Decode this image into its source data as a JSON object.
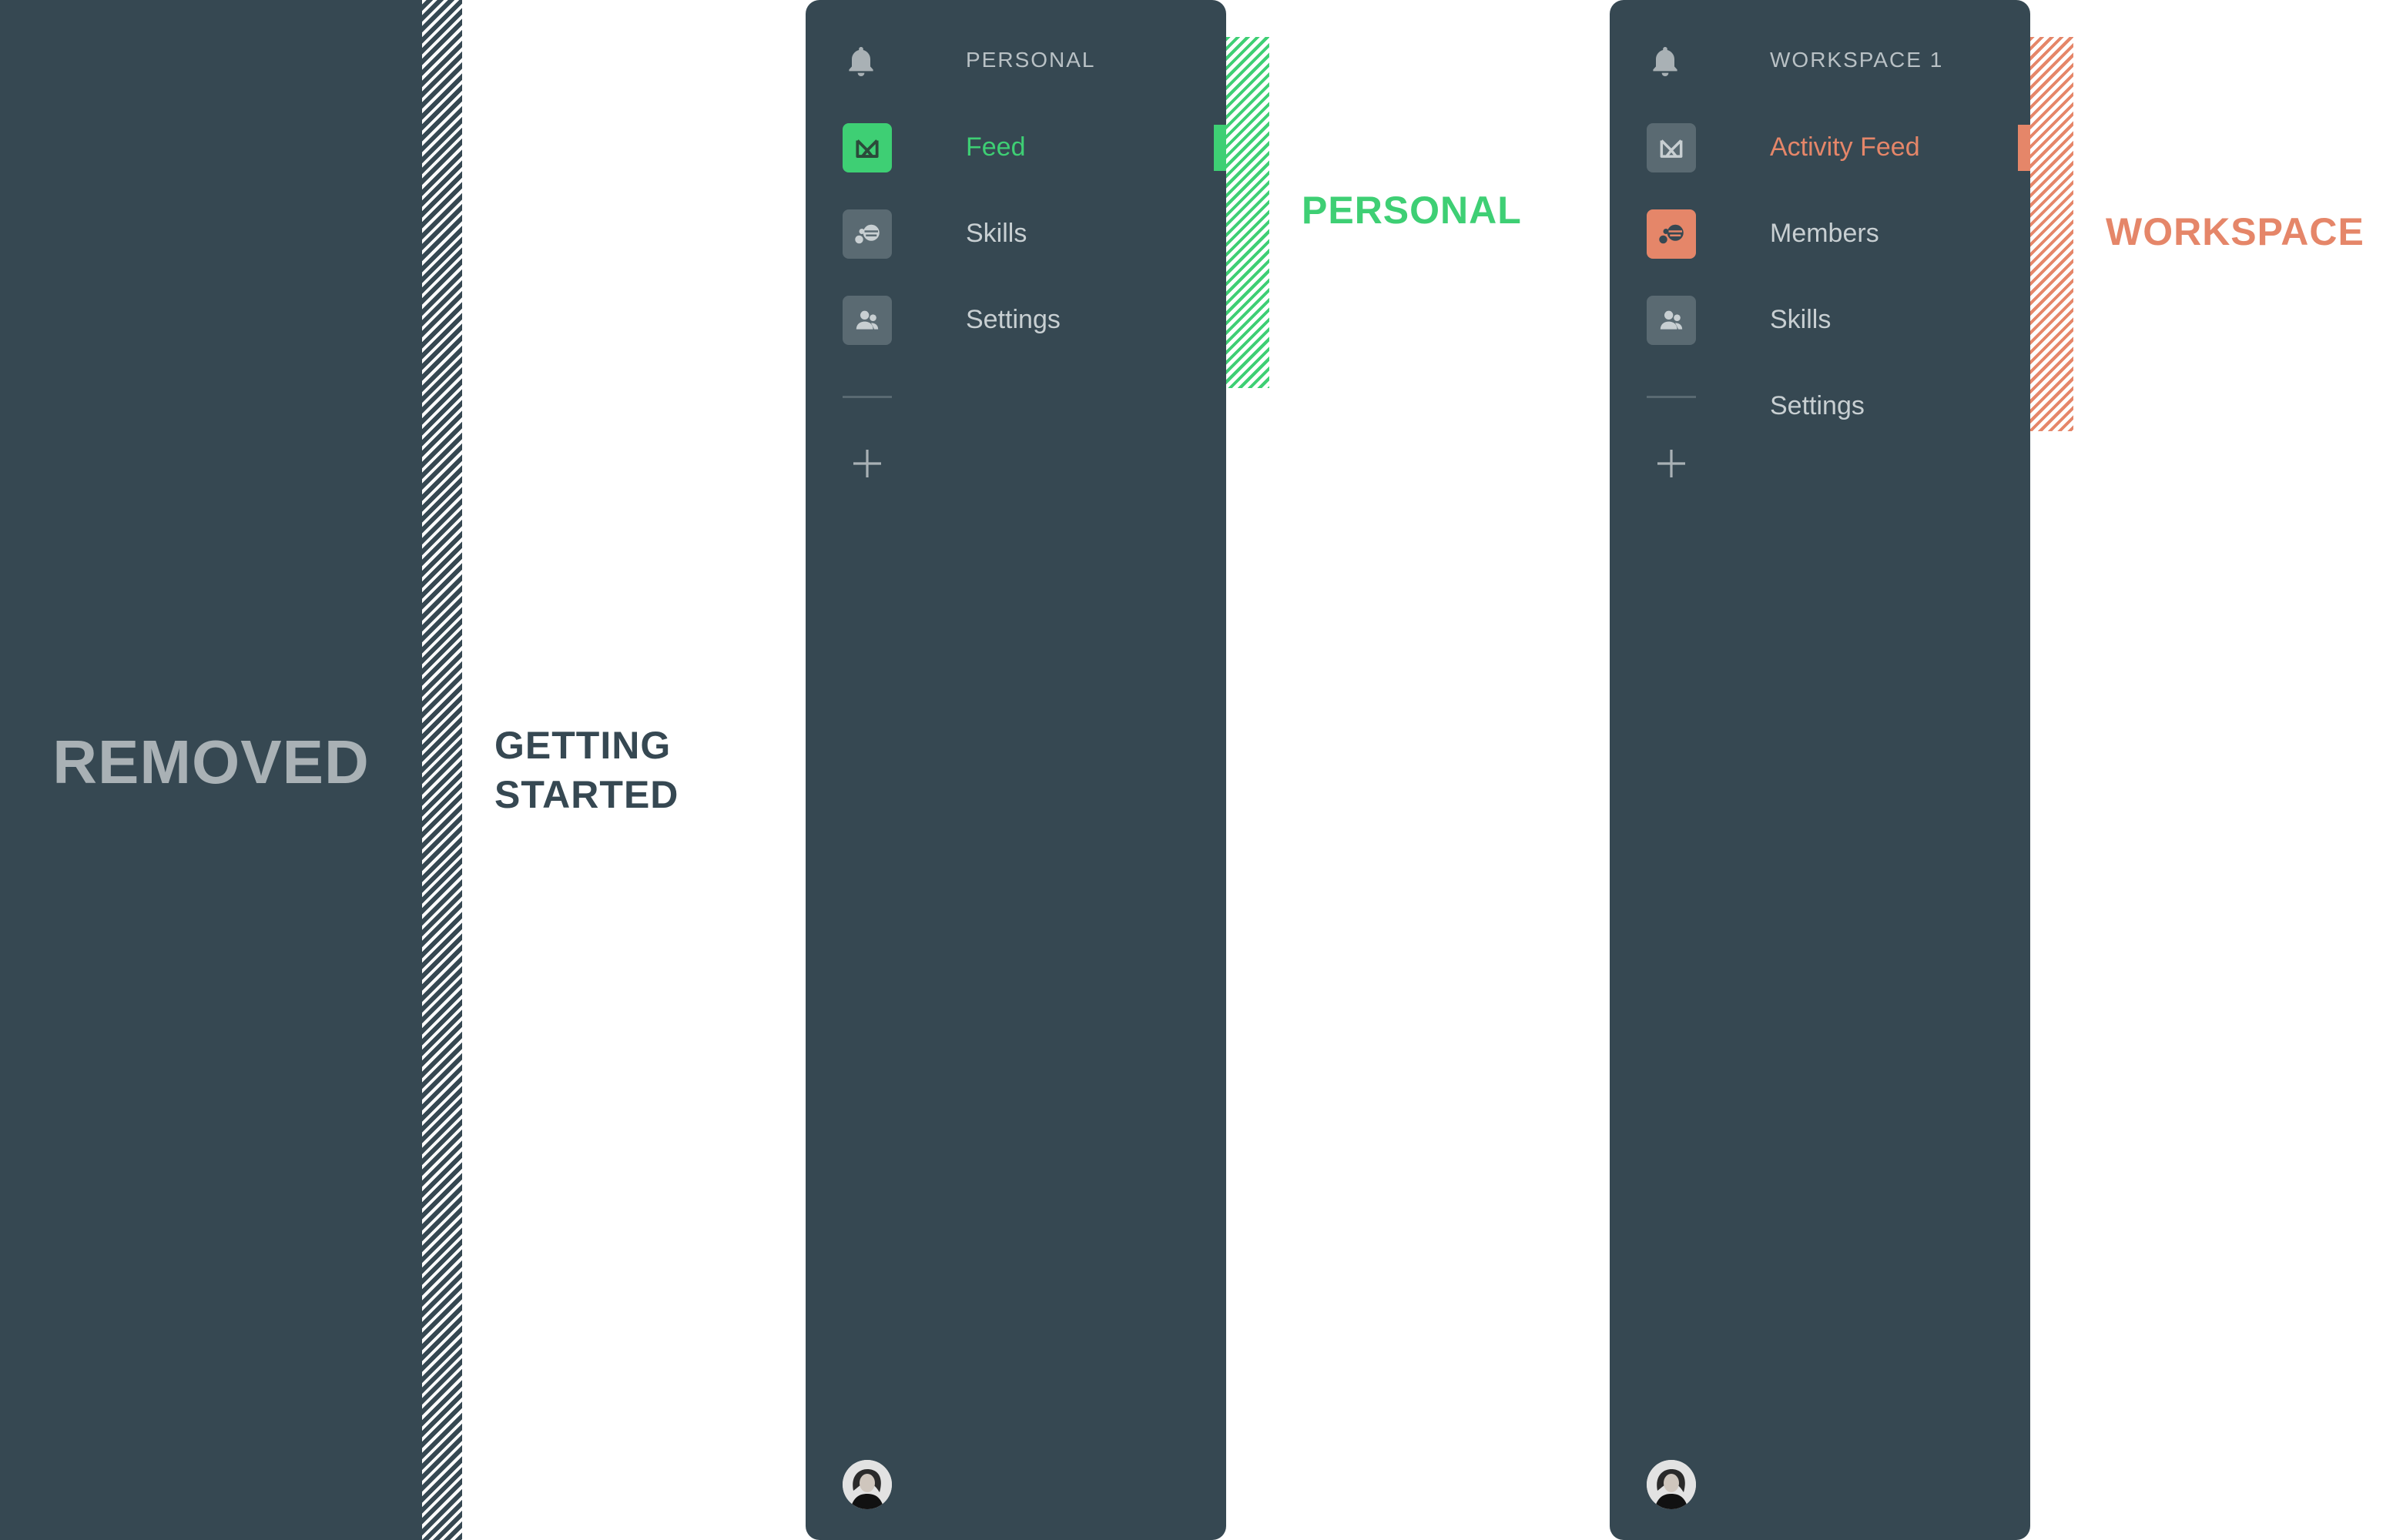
{
  "colors": {
    "panel": "#364852",
    "accent_personal": "#3ecf74",
    "accent_workspace": "#e58669",
    "muted_icon": "#5a6a72"
  },
  "removed": {
    "label": "REMOVED"
  },
  "getting_started": {
    "line1": "GETTING",
    "line2": "STARTED"
  },
  "personal": {
    "title": "PERSONAL",
    "callout": "PERSONAL",
    "items": [
      {
        "label": "Feed",
        "icon": "feed-icon",
        "active": true
      },
      {
        "label": "Skills",
        "icon": "skills-icon",
        "active": false
      },
      {
        "label": "Settings",
        "icon": "people-icon",
        "active": false
      }
    ]
  },
  "workspace": {
    "title": "WORKSPACE 1",
    "callout": "WORKSPACE",
    "items": [
      {
        "label": "Activity Feed",
        "icon": "feed-icon",
        "active": true
      },
      {
        "label": "Members",
        "icon": "skills-icon",
        "active": false
      },
      {
        "label": "Skills",
        "icon": "people-icon",
        "active": false
      },
      {
        "label": "Settings",
        "icon": "none",
        "active": false
      }
    ]
  }
}
